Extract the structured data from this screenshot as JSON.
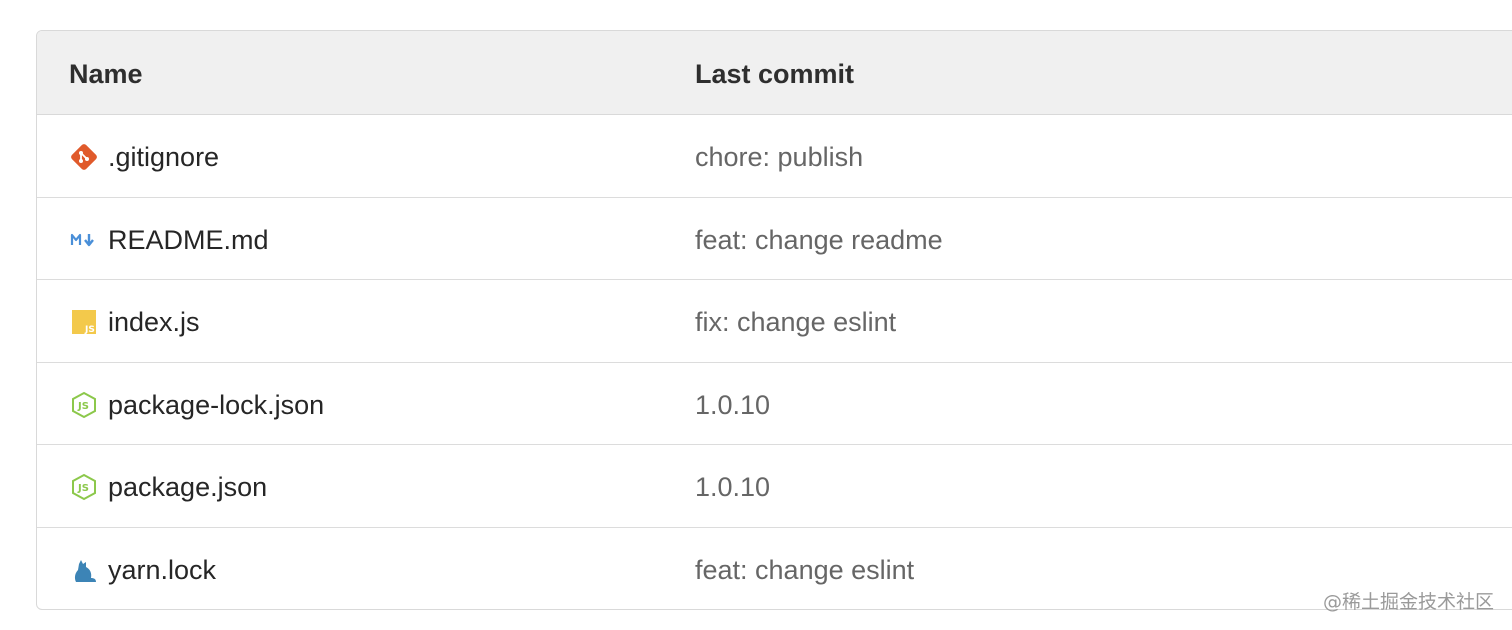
{
  "table": {
    "headers": {
      "name": "Name",
      "last_commit": "Last commit"
    },
    "rows": [
      {
        "icon": "git-icon",
        "name": ".gitignore",
        "commit": "chore: publish"
      },
      {
        "icon": "markdown-icon",
        "name": "README.md",
        "commit": "feat: change readme"
      },
      {
        "icon": "javascript-file-icon",
        "name": "index.js",
        "commit": "fix: change eslint"
      },
      {
        "icon": "nodejs-icon",
        "name": "package-lock.json",
        "commit": "1.0.10"
      },
      {
        "icon": "nodejs-icon",
        "name": "package.json",
        "commit": "1.0.10"
      },
      {
        "icon": "yarn-icon",
        "name": "yarn.lock",
        "commit": "feat: change eslint"
      }
    ]
  },
  "watermark": "@稀土掘金技术社区",
  "colors": {
    "header_bg": "#f0f0f0",
    "border": "#d9d9d9",
    "git": "#e05a2b",
    "markdown": "#4a8fd8",
    "javascript": "#f3c94b",
    "nodejs": "#8cc84b",
    "yarn": "#3c84b6"
  }
}
